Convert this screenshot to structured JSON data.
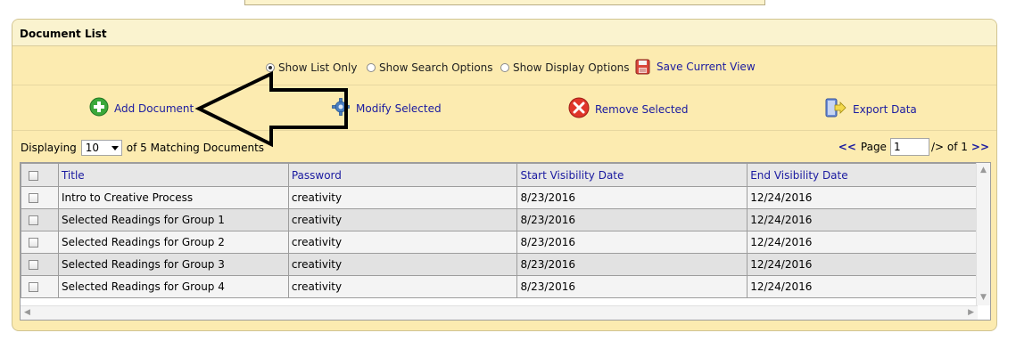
{
  "panel": {
    "title": "Document List"
  },
  "view_options": {
    "items": [
      {
        "label": "Show List Only",
        "selected": true
      },
      {
        "label": "Show Search Options",
        "selected": false
      },
      {
        "label": "Show Display Options",
        "selected": false
      }
    ],
    "save_view_label": "Save Current View"
  },
  "toolbar": {
    "add_label": "Add Document",
    "modify_label": "Modify Selected",
    "remove_label": "Remove Selected",
    "export_label": "Export Data"
  },
  "paging": {
    "displaying_label": "Displaying",
    "page_size": "10",
    "matching_label": "of 5 Matching Documents",
    "prev": "<<",
    "page_label": "Page",
    "page_value": "1",
    "of_label": "/> of 1",
    "next": ">>"
  },
  "grid": {
    "columns": [
      "Title",
      "Password",
      "Start Visibility Date",
      "End Visibility Date"
    ],
    "rows": [
      {
        "title": "Intro to Creative Process",
        "password": "creativity",
        "start": "8/23/2016",
        "end": "12/24/2016"
      },
      {
        "title": "Selected Readings for Group 1",
        "password": "creativity",
        "start": "8/23/2016",
        "end": "12/24/2016"
      },
      {
        "title": "Selected Readings for Group 2",
        "password": "creativity",
        "start": "8/23/2016",
        "end": "12/24/2016"
      },
      {
        "title": "Selected Readings for Group 3",
        "password": "creativity",
        "start": "8/23/2016",
        "end": "12/24/2016"
      },
      {
        "title": "Selected Readings for Group 4",
        "password": "creativity",
        "start": "8/23/2016",
        "end": "12/24/2016"
      }
    ]
  },
  "colors": {
    "panel_bg": "#fcebb0",
    "link": "#1a1aa0",
    "add_green": "#3aa83a",
    "remove_red": "#e0352a"
  },
  "icons": {
    "add": "plus-circle-icon",
    "modify": "gear-icon",
    "remove": "x-circle-icon",
    "export": "export-doc-icon",
    "save_view": "floppy-disk-icon",
    "annotation": "left-arrow-icon"
  }
}
